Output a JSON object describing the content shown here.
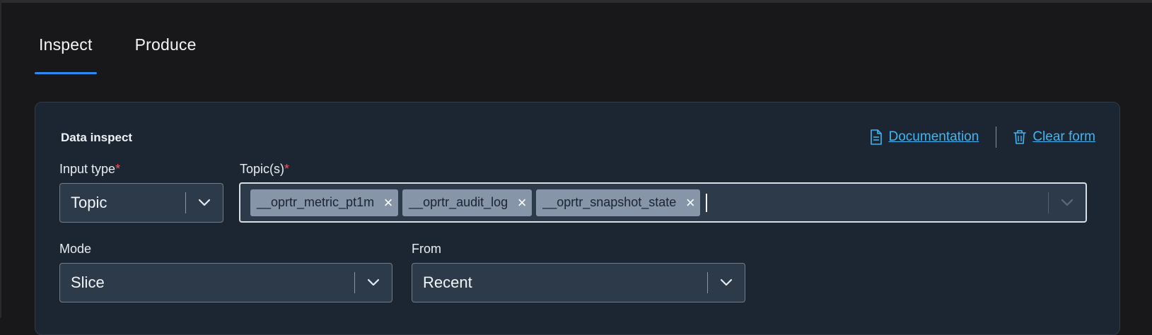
{
  "tabs": [
    {
      "label": "Inspect",
      "active": true
    },
    {
      "label": "Produce",
      "active": false
    }
  ],
  "card": {
    "title": "Data inspect",
    "documentation_label": "Documentation",
    "clear_label": "Clear form"
  },
  "form": {
    "input_type": {
      "label": "Input type",
      "required_mark": "*",
      "value": "Topic"
    },
    "topics": {
      "label": "Topic(s)",
      "required_mark": "*",
      "chips": [
        "__oprtr_metric_pt1m",
        "__oprtr_audit_log",
        "__oprtr_snapshot_state"
      ],
      "remove_glyph": "×"
    },
    "mode": {
      "label": "Mode",
      "value": "Slice"
    },
    "from": {
      "label": "From",
      "value": "Recent"
    }
  },
  "colors": {
    "accent": "#2a8bf2",
    "link": "#3fb6f2",
    "required": "#f05561",
    "chip_bg": "#8695a8"
  },
  "icons": {
    "documentation": "document-icon",
    "clear": "trash-icon",
    "select": "chevron-down-icon"
  }
}
